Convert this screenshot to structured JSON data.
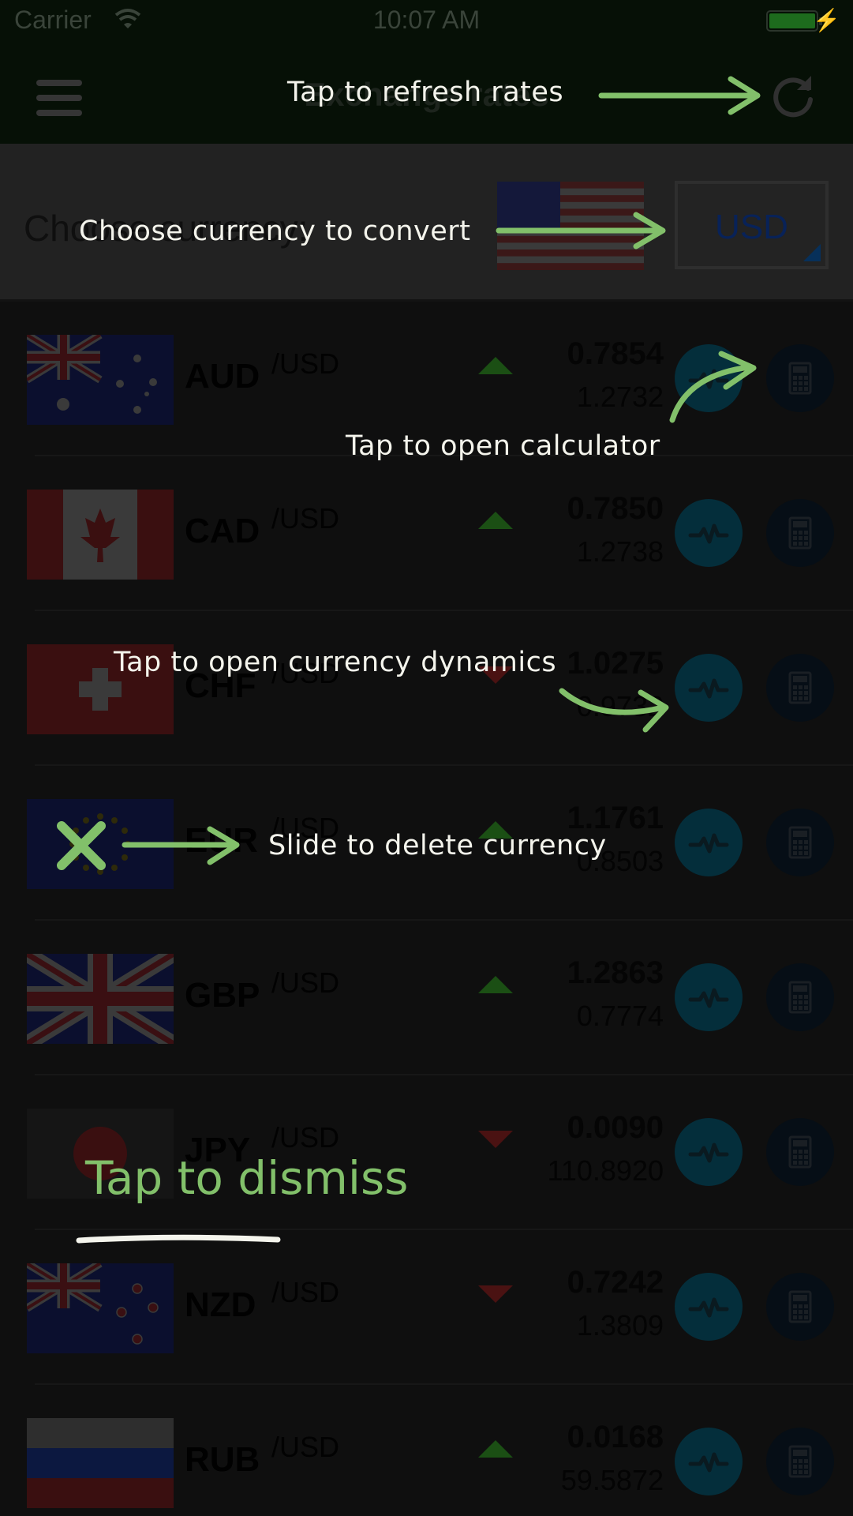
{
  "status_bar": {
    "carrier": "Carrier",
    "time": "10:07 AM",
    "wifi_icon": "wifi-icon",
    "battery_icon": "battery-icon"
  },
  "navbar": {
    "title": "Exchange rates",
    "menu_icon": "hamburger-menu-icon",
    "refresh_icon": "refresh-icon"
  },
  "chooser": {
    "label": "Choose currency:",
    "selected_currency": "USD",
    "selected_flag": "us-flag-icon"
  },
  "rates": [
    {
      "code": "AUD",
      "per": "/USD",
      "trend": "up",
      "rate": "0.7854",
      "inverse": "1.2732",
      "flag": "au-flag-icon"
    },
    {
      "code": "CAD",
      "per": "/USD",
      "trend": "up",
      "rate": "0.7850",
      "inverse": "1.2738",
      "flag": "ca-flag-icon"
    },
    {
      "code": "CHF",
      "per": "/USD",
      "trend": "down",
      "rate": "1.0275",
      "inverse": "0.9732",
      "flag": "ch-flag-icon"
    },
    {
      "code": "EUR",
      "per": "/USD",
      "trend": "up",
      "rate": "1.1761",
      "inverse": "0.8503",
      "flag": "eu-flag-icon"
    },
    {
      "code": "GBP",
      "per": "/USD",
      "trend": "up",
      "rate": "1.2863",
      "inverse": "0.7774",
      "flag": "gb-flag-icon"
    },
    {
      "code": "JPY",
      "per": "/USD",
      "trend": "down",
      "rate": "0.0090",
      "inverse": "110.8920",
      "flag": "jp-flag-icon"
    },
    {
      "code": "NZD",
      "per": "/USD",
      "trend": "down",
      "rate": "0.7242",
      "inverse": "1.3809",
      "flag": "nz-flag-icon"
    },
    {
      "code": "RUB",
      "per": "/USD",
      "trend": "up",
      "rate": "0.0168",
      "inverse": "59.5872",
      "flag": "ru-flag-icon"
    }
  ],
  "colors": {
    "accent_green": "#82c06a",
    "trend_up": "#1b4f14",
    "trend_down": "#4a1212",
    "dynamics_button": "#042e3b",
    "calculator_button": "#060e16"
  },
  "overlay": {
    "refresh_hint": "Tap to refresh rates",
    "convert_hint": "Choose currency to convert",
    "calculator_hint": "Tap to open calculator",
    "dynamics_hint": "Tap to open currency dynamics",
    "delete_hint": "Slide to delete currency",
    "dismiss": "Tap to dismiss"
  }
}
